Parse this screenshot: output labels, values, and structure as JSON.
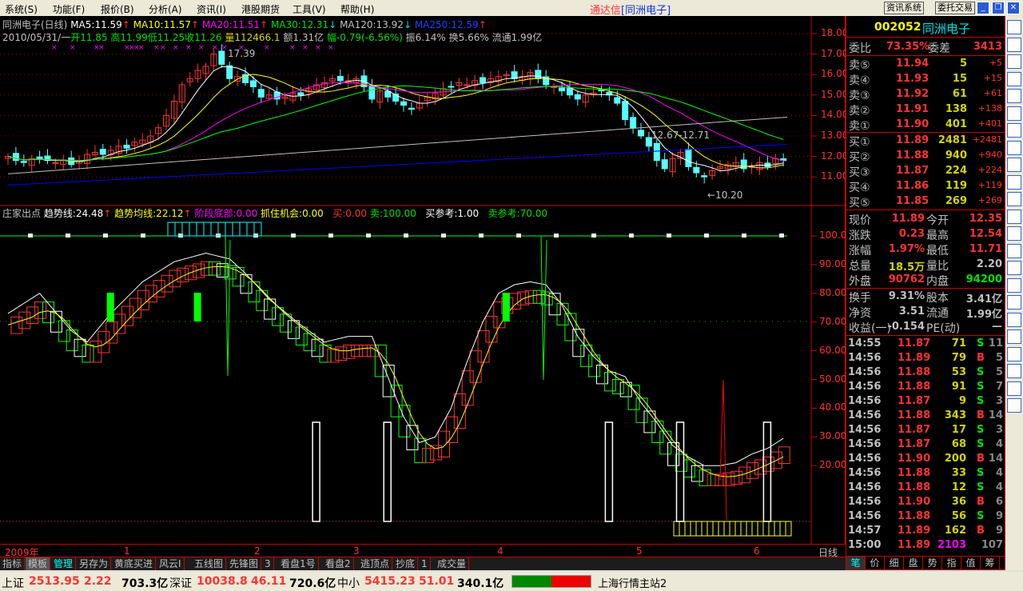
{
  "menu": [
    "系统(S)",
    "功能(F)",
    "报价(B)",
    "分析(A)",
    "资讯(I)",
    "港股期货",
    "工具(V)",
    "帮助(H)"
  ],
  "app_title": {
    "name": "通达信",
    "stock": "[同洲电子]"
  },
  "top_buttons": [
    "资讯系统",
    "委托交易"
  ],
  "window_buttons": {
    "minimize": "_",
    "restore": "❐",
    "close": "✕"
  },
  "ma_line": {
    "name": "同洲电子(日线)",
    "ma5": "MA5:11.59",
    "ma10": "MA10:11.57",
    "ma20": "MA20:11.51",
    "ma30": "MA30:12.31",
    "ma120": "MA120:13.92",
    "ma250": "MA250:12.59"
  },
  "bar_info": {
    "date": "2010/05/31/一",
    "open": "开11.85",
    "high": "高11.99",
    "low": "低11.25",
    "close": "收11.26",
    "vol": "量112466.1",
    "amount": "额1.31亿",
    "change": "幅-0.79(-6.56%)",
    "amp": "振6.14%",
    "turnover": "换5.66%",
    "float": "流通1.99亿"
  },
  "annotations": {
    "high": "17.39",
    "range": "12.67-12.71",
    "low": "←10.20"
  },
  "colors": {
    "up": "#ff3232",
    "down": "#54ffff",
    "ma5": "#ffffff",
    "ma10": "#ffff00",
    "ma20": "#ff00ff",
    "ma30": "#00ff00",
    "ma120": "#c0c0c0",
    "ma250": "#0000ff"
  },
  "price_axis": [
    "18.00",
    "17.00",
    "16.00",
    "15.00",
    "14.00",
    "13.00",
    "12.00",
    "11.00"
  ],
  "closes": [
    12.0,
    11.8,
    11.7,
    11.9,
    11.9,
    11.8,
    11.7,
    11.8,
    11.6,
    11.8,
    12.1,
    12.2,
    12.1,
    12.3,
    12.5,
    12.4,
    12.7,
    12.8,
    13.0,
    13.4,
    14.0,
    14.7,
    15.5,
    15.8,
    16.2,
    16.4,
    17.0,
    16.5,
    15.8,
    15.9,
    15.6,
    15.4,
    14.9,
    15.0,
    14.8,
    14.9,
    15.1,
    15.0,
    15.3,
    15.5,
    15.6,
    15.8,
    15.7,
    15.7,
    15.8,
    15.4,
    14.8,
    15.2,
    14.9,
    14.7,
    14.5,
    14.3,
    14.6,
    14.9,
    15.1,
    15.3,
    15.4,
    15.6,
    15.5,
    15.7,
    15.6,
    15.8,
    15.9,
    16.0,
    15.8,
    15.9,
    16.1,
    15.8,
    15.5,
    15.4,
    15.2,
    15.0,
    14.8,
    15.0,
    15.1,
    15.2,
    15.0,
    14.6,
    13.8,
    13.4,
    13.0,
    12.5,
    11.8,
    11.4,
    11.9,
    12.2,
    11.5,
    11.2,
    11.0,
    11.3,
    11.5,
    11.6,
    11.7,
    11.4,
    11.5,
    11.7,
    11.5,
    11.9,
    11.8
  ],
  "ma_long": {
    "ma120": [
      11.15,
      13.92
    ],
    "ma250": [
      10.6,
      12.59
    ]
  },
  "indicator": {
    "header": {
      "name": "庄家出点",
      "trend": "趋势线:24.48",
      "trend_avg": "趋势均线:22.12",
      "stage_bottom": "阶段底部:0.00",
      "chance": "抓住机会:0.00",
      "buy": "买:0.00",
      "sell": "卖:100.00",
      "buy_ref": "买参考:1.00",
      "sell_ref": "卖参考:70.00"
    },
    "axis": [
      "100.00",
      "90.00",
      "80.00",
      "70.00",
      "60.00",
      "50.00",
      "40.00",
      "30.00",
      "20.00"
    ],
    "trend_points": [
      [
        0,
        68
      ],
      [
        4,
        75
      ],
      [
        8,
        62
      ],
      [
        10,
        58
      ],
      [
        13,
        68
      ],
      [
        17,
        79
      ],
      [
        21,
        86
      ],
      [
        25,
        89
      ],
      [
        28,
        87
      ],
      [
        30,
        82
      ],
      [
        33,
        73
      ],
      [
        37,
        64
      ],
      [
        40,
        58
      ],
      [
        43,
        60
      ],
      [
        46,
        60
      ],
      [
        48,
        46
      ],
      [
        50,
        32
      ],
      [
        52,
        23
      ],
      [
        54,
        25
      ],
      [
        56,
        35
      ],
      [
        58,
        51
      ],
      [
        60,
        65
      ],
      [
        62,
        75
      ],
      [
        64,
        78
      ],
      [
        66,
        79
      ],
      [
        68,
        78
      ],
      [
        70,
        71
      ],
      [
        72,
        60
      ],
      [
        74,
        53
      ],
      [
        76,
        48
      ],
      [
        78,
        46
      ],
      [
        80,
        37
      ],
      [
        82,
        30
      ],
      [
        84,
        22
      ],
      [
        86,
        18
      ],
      [
        88,
        15
      ],
      [
        90,
        15
      ],
      [
        92,
        16
      ],
      [
        94,
        19
      ],
      [
        96,
        21
      ],
      [
        98,
        24.5
      ]
    ],
    "sell_signal_bars": [
      39,
      48,
      76,
      85,
      96
    ],
    "green_bars": [
      13,
      24,
      63
    ]
  },
  "time_axis": {
    "year": "2009年",
    "months": [
      "1",
      "2",
      "3",
      "4",
      "5",
      "6"
    ],
    "period": "日线"
  },
  "tabs": [
    "指标",
    "模板",
    "管理",
    "另存为",
    "黄底买进",
    "风云I",
    "五线图",
    "先锋图",
    "3",
    "看盘1号",
    "看盘2",
    "逃顶点",
    "抄底",
    "1",
    "成交量"
  ],
  "quote": {
    "code": "002052",
    "name": "同洲电子",
    "wb_label": "委比",
    "wb": "73.35%",
    "wc_label": "委差",
    "wc": "3413",
    "asks": [
      {
        "l": "卖⑤",
        "p": "11.94",
        "v": "5",
        "d": "+5"
      },
      {
        "l": "卖④",
        "p": "11.93",
        "v": "15",
        "d": "+15"
      },
      {
        "l": "卖③",
        "p": "11.92",
        "v": "61",
        "d": "+61"
      },
      {
        "l": "卖②",
        "p": "11.91",
        "v": "138",
        "d": "+138"
      },
      {
        "l": "卖①",
        "p": "11.90",
        "v": "401",
        "d": "+401"
      }
    ],
    "bids": [
      {
        "l": "买①",
        "p": "11.89",
        "v": "2481",
        "d": "+2481"
      },
      {
        "l": "买②",
        "p": "11.88",
        "v": "940",
        "d": "+940"
      },
      {
        "l": "买③",
        "p": "11.87",
        "v": "224",
        "d": "+224"
      },
      {
        "l": "买④",
        "p": "11.86",
        "v": "119",
        "d": "+119"
      },
      {
        "l": "买⑤",
        "p": "11.85",
        "v": "269",
        "d": "+269"
      }
    ],
    "stats": [
      [
        "现价",
        "11.89",
        "今开",
        "12.35"
      ],
      [
        "涨跌",
        "0.23",
        "最高",
        "12.54"
      ],
      [
        "涨幅",
        "1.97%",
        "最低",
        "11.71"
      ],
      [
        "总量",
        "18.5万",
        "量比",
        "2.20"
      ],
      [
        "外盘",
        "90762",
        "内盘",
        "94200"
      ]
    ],
    "stats2": [
      [
        "换手",
        "9.31%",
        "股本",
        "3.41亿"
      ],
      [
        "净资",
        "3.51",
        "流通",
        "1.99亿"
      ],
      [
        "收益(一)",
        "-0.154",
        "PE(动)",
        "—"
      ]
    ]
  },
  "ticks": [
    [
      "14:55",
      "11.87",
      "71",
      "S",
      "11"
    ],
    [
      "14:56",
      "11.89",
      "79",
      "B",
      "5"
    ],
    [
      "14:56",
      "11.88",
      "53",
      "S",
      "5"
    ],
    [
      "14:56",
      "11.88",
      "91",
      "S",
      "7"
    ],
    [
      "14:56",
      "11.87",
      "9",
      "S",
      "3"
    ],
    [
      "14:56",
      "11.88",
      "343",
      "B",
      "14"
    ],
    [
      "14:56",
      "11.87",
      "17",
      "S",
      "3"
    ],
    [
      "14:56",
      "11.87",
      "68",
      "S",
      "4"
    ],
    [
      "14:56",
      "11.90",
      "200",
      "B",
      "14"
    ],
    [
      "14:56",
      "11.88",
      "33",
      "S",
      "4"
    ],
    [
      "14:56",
      "11.88",
      "12",
      "S",
      "4"
    ],
    [
      "14:56",
      "11.90",
      "36",
      "B",
      "6"
    ],
    [
      "14:56",
      "11.88",
      "56",
      "S",
      "9"
    ],
    [
      "14:57",
      "11.89",
      "162",
      "B",
      "9"
    ],
    [
      "15:00",
      "11.89",
      "2103",
      "",
      "107"
    ]
  ],
  "right_tabs": [
    "笔",
    "价",
    "细",
    "盘",
    "势",
    "指",
    "值",
    "筹"
  ],
  "status": {
    "sh_label": "上证",
    "sh": "2513.95",
    "sh_chg": "2.22",
    "sh_amt": "703.3亿",
    "sz_label": "深证",
    "sz": "10038.8",
    "sz_chg": "46.11",
    "sz_amt": "720.6亿",
    "zx_label": "中小",
    "zx": "5415.23",
    "zx_chg": "51.01",
    "zx_amt": "340.1亿",
    "server": "上海行情主站2"
  }
}
